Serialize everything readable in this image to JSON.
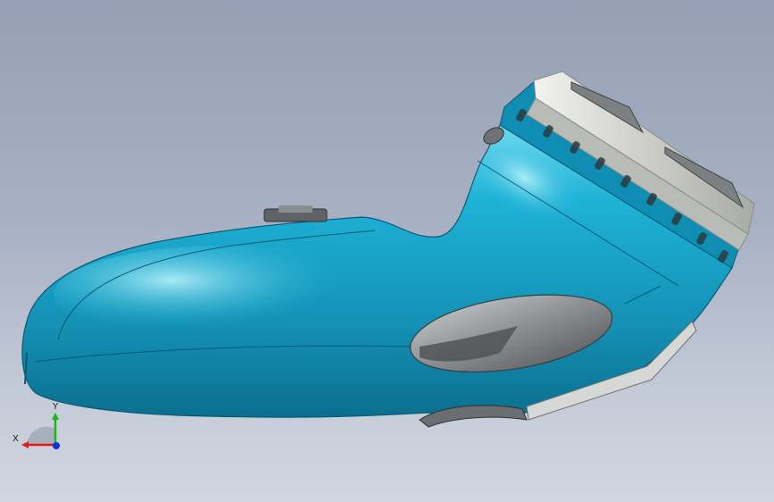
{
  "viewport": {
    "background_top": "#95a0b5",
    "background_bottom": "#d2d6e0"
  },
  "model": {
    "body_color": "#1fb3d8",
    "body_highlight": "#8fe6f5",
    "body_shadow": "#0b6f8e",
    "trim_color": "#8e9294",
    "head_color": "#d9dad4",
    "grip_color": "#767a7c",
    "icons": [
      "shaver-body",
      "shaver-head",
      "side-grip",
      "power-button"
    ]
  },
  "triad": {
    "x_label": "X",
    "y_label": "Y",
    "x_color": "#e01818",
    "y_color": "#19b719",
    "z_color": "#1030e0"
  }
}
